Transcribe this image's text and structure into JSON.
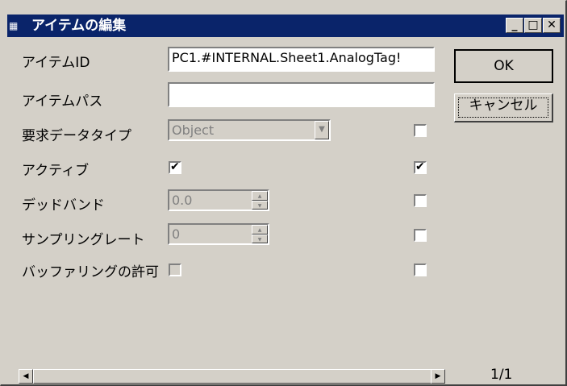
{
  "window": {
    "title": "アイテムの編集",
    "app_icon": "app-icon",
    "controls": {
      "minimize": "_",
      "maximize": "□",
      "close": "✕"
    }
  },
  "fields": [
    {
      "label": "アイテムID",
      "type": "text",
      "value": "PC1.#INTERNAL.Sheet1.AnalogTag!"
    },
    {
      "label": "アイテムパス",
      "type": "text",
      "value": ""
    },
    {
      "label": "要求データタイプ",
      "type": "select",
      "value": "Object",
      "enabled": false
    },
    {
      "label": "アクティブ",
      "type": "checkbox",
      "checked": true
    },
    {
      "label": "デッドバンド",
      "type": "spinner",
      "value": "0.0",
      "enabled": false
    },
    {
      "label": "サンプリングレート",
      "type": "spinner",
      "value": "0",
      "enabled": false
    },
    {
      "label": "バッファリングの許可",
      "type": "checkbox",
      "checked": false,
      "enabled": false
    }
  ],
  "right_checks": [
    false,
    true,
    false,
    false,
    false
  ],
  "buttons": {
    "ok": "OK",
    "cancel": "キャンセル"
  },
  "pager": "1/1",
  "scrollbar": {
    "left_arrow": "◀",
    "right_arrow": "▶"
  },
  "check_mark": "✔",
  "dropdown_arrow": "▼",
  "spin_up": "▲",
  "spin_down": "▼",
  "colors": {
    "titlebar": "#0a246a",
    "face": "#d4d0c8"
  }
}
